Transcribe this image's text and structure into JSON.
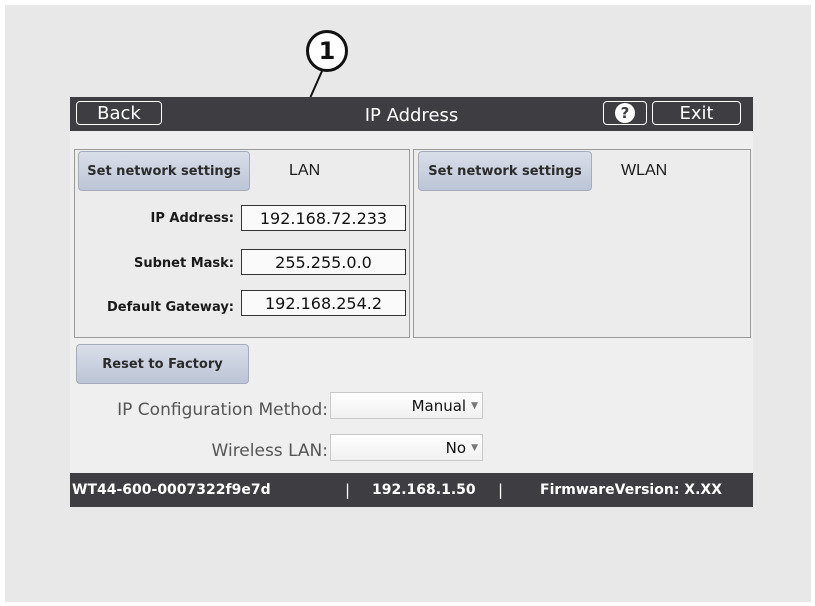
{
  "callout": {
    "number": "1"
  },
  "titlebar": {
    "back_label": "Back",
    "title": "IP Address",
    "help_symbol": "?",
    "exit_label": "Exit"
  },
  "lan_panel": {
    "button_label": "Set network settings",
    "label": "LAN",
    "fields": [
      {
        "label": "IP Address:",
        "value": "192.168.72.233"
      },
      {
        "label": "Subnet Mask:",
        "value": "255.255.0.0"
      },
      {
        "label": "Default Gateway:",
        "value": "192.168.254.2"
      }
    ]
  },
  "wlan_panel": {
    "button_label": "Set network settings",
    "label": "WLAN"
  },
  "reset_label": "Reset to Factory",
  "ip_config": {
    "label": "IP Configuration Method:",
    "value": "Manual"
  },
  "wireless_lan": {
    "label": "Wireless LAN:",
    "value": "No"
  },
  "statusbar": {
    "device_id": "WT44-600-0007322f9e7d",
    "ip": "192.168.1.50",
    "firmware": "FirmwareVersion: X.XX",
    "separator": "|"
  },
  "icons": {
    "help": "help-icon",
    "dropdown": "chevron-down-icon"
  },
  "colors": {
    "bar": "#3e3e42",
    "button": "#c8cfdd",
    "panel": "#ececec"
  }
}
